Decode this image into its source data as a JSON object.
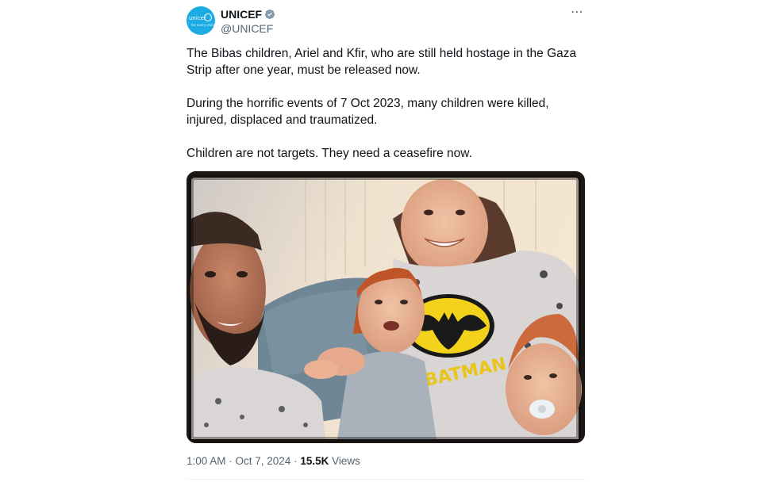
{
  "account": {
    "name": "UNICEF",
    "handle": "@UNICEF",
    "avatar_text": "unicef",
    "avatar_subtext": "for every child",
    "verified": true,
    "verified_color": "#829aab",
    "brand_color": "#1cabe2"
  },
  "menu": {
    "more_icon": "⋯"
  },
  "tweet": {
    "paragraphs": [
      "The Bibas children, Ariel and Kfir, who are still held hostage in the Gaza Strip after one year, must be released now.",
      "During the horrific events of 7 Oct 2023, many children were killed, injured, displaced and traumatized.",
      "Children are not targets. They need a ceasefire now."
    ],
    "image_alt": "Family photo of a man, a woman in a Batman shirt, a smiling red-haired boy and a baby with a pacifier"
  },
  "meta": {
    "time": "1:00 AM",
    "separator": " · ",
    "date": "Oct 7, 2024",
    "views_count": "15.5K",
    "views_label": "Views"
  }
}
